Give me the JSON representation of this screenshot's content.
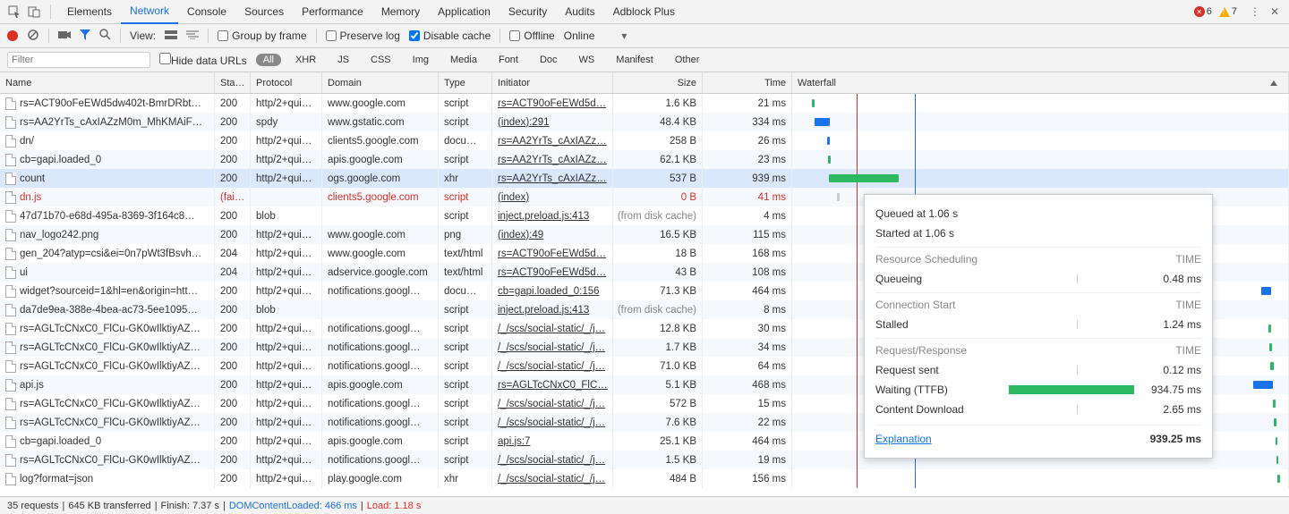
{
  "tabs": {
    "items": [
      "Elements",
      "Network",
      "Console",
      "Sources",
      "Performance",
      "Memory",
      "Application",
      "Security",
      "Audits",
      "Adblock Plus"
    ],
    "active": 1,
    "errors": "6",
    "warnings": "7"
  },
  "toolbar": {
    "view": "View:",
    "group": "Group by frame",
    "preserve": "Preserve log",
    "disable": "Disable cache",
    "offline": "Offline",
    "online": "Online",
    "disable_checked": true
  },
  "filter": {
    "placeholder": "Filter",
    "hide": "Hide data URLs",
    "chips": [
      "All",
      "XHR",
      "JS",
      "CSS",
      "Img",
      "Media",
      "Font",
      "Doc",
      "WS",
      "Manifest",
      "Other"
    ],
    "active": 0
  },
  "cols": {
    "name": "Name",
    "status": "Sta…",
    "protocol": "Protocol",
    "domain": "Domain",
    "type": "Type",
    "initiator": "Initiator",
    "size": "Size",
    "time": "Time",
    "waterfall": "Waterfall"
  },
  "rows": [
    {
      "name": "rs=ACT90oFeEWd5dw402t-BmrDRbt…",
      "status": "200",
      "proto": "http/2+qui…",
      "domain": "www.google.com",
      "type": "script",
      "init": "rs=ACT90oFeEWd5d…",
      "size": "1.6 KB",
      "time": "21 ms",
      "bar": {
        "l": 4.0,
        "w": 0.6,
        "c": "#2db862"
      }
    },
    {
      "name": "rs=AA2YrTs_cAxIAZzM0m_MhKMAiF…",
      "status": "200",
      "proto": "spdy",
      "domain": "www.gstatic.com",
      "type": "script",
      "init": "(index):291",
      "size": "48.4 KB",
      "time": "334 ms",
      "bar": {
        "l": 4.5,
        "w": 3.0,
        "c": "#1a73e8"
      }
    },
    {
      "name": "dn/",
      "status": "200",
      "proto": "http/2+qui…",
      "domain": "clients5.google.com",
      "type": "docu…",
      "init": "rs=AA2YrTs_cAxIAZz…",
      "size": "258 B",
      "time": "26 ms",
      "bar": {
        "l": 7.0,
        "w": 0.6,
        "c": "#1a73e8"
      }
    },
    {
      "name": "cb=gapi.loaded_0",
      "status": "200",
      "proto": "http/2+qui…",
      "domain": "apis.google.com",
      "type": "script",
      "init": "rs=AA2YrTs_cAxIAZz…",
      "size": "62.1 KB",
      "time": "23 ms",
      "bar": {
        "l": 7.2,
        "w": 0.6,
        "c": "#2db862"
      }
    },
    {
      "name": "count",
      "status": "200",
      "proto": "http/2+qui…",
      "domain": "ogs.google.com",
      "type": "xhr",
      "init": "rs=AA2YrTs_cAxIAZz…",
      "size": "537 B",
      "time": "939 ms",
      "bar": {
        "l": 7.4,
        "w": 14.0,
        "c": "#2db862"
      },
      "selected": true
    },
    {
      "name": "dn.js",
      "status": "(fai…",
      "proto": "",
      "domain": "clients5.google.com",
      "type": "script",
      "init": "(index)",
      "size": "0 B",
      "time": "41 ms",
      "err": true,
      "bar": {
        "l": 9.0,
        "w": 0.6,
        "c": "#ccc"
      }
    },
    {
      "name": "47d71b70-e68d-495a-8369-3f164c8…",
      "status": "200",
      "proto": "blob",
      "domain": "",
      "type": "script",
      "init": "inject.preload.js:413",
      "size": "(from disk cache)",
      "time": "4 ms",
      "muted_size": true
    },
    {
      "name": "nav_logo242.png",
      "status": "200",
      "proto": "http/2+qui…",
      "domain": "www.google.com",
      "type": "png",
      "init": "(index):49",
      "size": "16.5 KB",
      "time": "115 ms"
    },
    {
      "name": "gen_204?atyp=csi&ei=0n7pWt3fBsvh…",
      "status": "204",
      "proto": "http/2+qui…",
      "domain": "www.google.com",
      "type": "text/html",
      "init": "rs=ACT90oFeEWd5d…",
      "size": "18 B",
      "time": "168 ms"
    },
    {
      "name": "ui",
      "status": "204",
      "proto": "http/2+qui…",
      "domain": "adservice.google.com",
      "type": "text/html",
      "init": "rs=ACT90oFeEWd5d…",
      "size": "43 B",
      "time": "108 ms",
      "icon": true
    },
    {
      "name": "widget?sourceid=1&hl=en&origin=htt…",
      "status": "200",
      "proto": "http/2+qui…",
      "domain": "notifications.googl…",
      "type": "docu…",
      "init": "cb=gapi.loaded_0:156",
      "size": "71.3 KB",
      "time": "464 ms",
      "bar": {
        "l": 94.5,
        "w": 2.0,
        "c": "#1a73e8"
      }
    },
    {
      "name": "da7de9ea-388e-4bea-ac73-5ee1095…",
      "status": "200",
      "proto": "blob",
      "domain": "",
      "type": "script",
      "init": "inject.preload.js:413",
      "size": "(from disk cache)",
      "time": "8 ms",
      "muted_size": true
    },
    {
      "name": "rs=AGLTcCNxC0_FlCu-GK0wIlktiyAZ…",
      "status": "200",
      "proto": "http/2+qui…",
      "domain": "notifications.googl…",
      "type": "script",
      "init": "/_/scs/social-static/_/j…",
      "size": "12.8 KB",
      "time": "30 ms",
      "bar": {
        "l": 96.0,
        "w": 0.5,
        "c": "#2db862"
      }
    },
    {
      "name": "rs=AGLTcCNxC0_FlCu-GK0wIlktiyAZ…",
      "status": "200",
      "proto": "http/2+qui…",
      "domain": "notifications.googl…",
      "type": "script",
      "init": "/_/scs/social-static/_/j…",
      "size": "1.7 KB",
      "time": "34 ms",
      "bar": {
        "l": 96.2,
        "w": 0.5,
        "c": "#2db862"
      }
    },
    {
      "name": "rs=AGLTcCNxC0_FlCu-GK0wIlktiyAZ…",
      "status": "200",
      "proto": "http/2+qui…",
      "domain": "notifications.googl…",
      "type": "script",
      "init": "/_/scs/social-static/_/j…",
      "size": "71.0 KB",
      "time": "64 ms",
      "bar": {
        "l": 96.4,
        "w": 0.7,
        "c": "#2db862"
      }
    },
    {
      "name": "api.js",
      "status": "200",
      "proto": "http/2+qui…",
      "domain": "apis.google.com",
      "type": "script",
      "init": "rs=AGLTcCNxC0_FlC…",
      "size": "5.1 KB",
      "time": "468 ms",
      "bar": {
        "l": 93.0,
        "w": 4.0,
        "c": "#1a73e8"
      }
    },
    {
      "name": "rs=AGLTcCNxC0_FlCu-GK0wIlktiyAZ…",
      "status": "200",
      "proto": "http/2+qui…",
      "domain": "notifications.googl…",
      "type": "script",
      "init": "/_/scs/social-static/_/j…",
      "size": "572 B",
      "time": "15 ms",
      "bar": {
        "l": 97.0,
        "w": 0.4,
        "c": "#2db862"
      }
    },
    {
      "name": "rs=AGLTcCNxC0_FlCu-GK0wIlktiyAZ…",
      "status": "200",
      "proto": "http/2+qui…",
      "domain": "notifications.googl…",
      "type": "script",
      "init": "/_/scs/social-static/_/j…",
      "size": "7.6 KB",
      "time": "22 ms",
      "bar": {
        "l": 97.2,
        "w": 0.4,
        "c": "#2db862"
      }
    },
    {
      "name": "cb=gapi.loaded_0",
      "status": "200",
      "proto": "http/2+qui…",
      "domain": "apis.google.com",
      "type": "script",
      "init": "api.js:7",
      "size": "25.1 KB",
      "time": "464 ms",
      "bar": {
        "l": 97.4,
        "w": 0.5,
        "c": "#2db862"
      }
    },
    {
      "name": "rs=AGLTcCNxC0_FlCu-GK0wIlktiyAZ…",
      "status": "200",
      "proto": "http/2+qui…",
      "domain": "notifications.googl…",
      "type": "script",
      "init": "/_/scs/social-static/_/j…",
      "size": "1.5 KB",
      "time": "19 ms",
      "bar": {
        "l": 97.6,
        "w": 0.4,
        "c": "#2db862"
      }
    },
    {
      "name": "log?format=json",
      "status": "200",
      "proto": "http/2+qui…",
      "domain": "play.google.com",
      "type": "xhr",
      "init": "/_/scs/social-static/_/j…",
      "size": "484 B",
      "time": "156 ms",
      "bar": {
        "l": 97.8,
        "w": 0.5,
        "c": "#2db862"
      }
    }
  ],
  "popup": {
    "queued": "Queued at 1.06 s",
    "started": "Started at 1.06 s",
    "sections": [
      {
        "hdr": "Resource Scheduling",
        "time": "TIME",
        "items": [
          {
            "k": "Queueing",
            "v": "0.48 ms",
            "bar": false
          }
        ]
      },
      {
        "hdr": "Connection Start",
        "time": "TIME",
        "items": [
          {
            "k": "Stalled",
            "v": "1.24 ms",
            "bar": false
          }
        ]
      },
      {
        "hdr": "Request/Response",
        "time": "TIME",
        "items": [
          {
            "k": "Request sent",
            "v": "0.12 ms",
            "bar": false
          },
          {
            "k": "Waiting (TTFB)",
            "v": "934.75 ms",
            "bar": true
          },
          {
            "k": "Content Download",
            "v": "2.65 ms",
            "bar": false
          }
        ]
      }
    ],
    "explanation": "Explanation",
    "total": "939.25 ms"
  },
  "status": {
    "requests": "35 requests",
    "transferred": "645 KB transferred",
    "finish": "Finish: 7.37 s",
    "dcl": "DOMContentLoaded: 466 ms",
    "load": "Load: 1.18 s"
  }
}
